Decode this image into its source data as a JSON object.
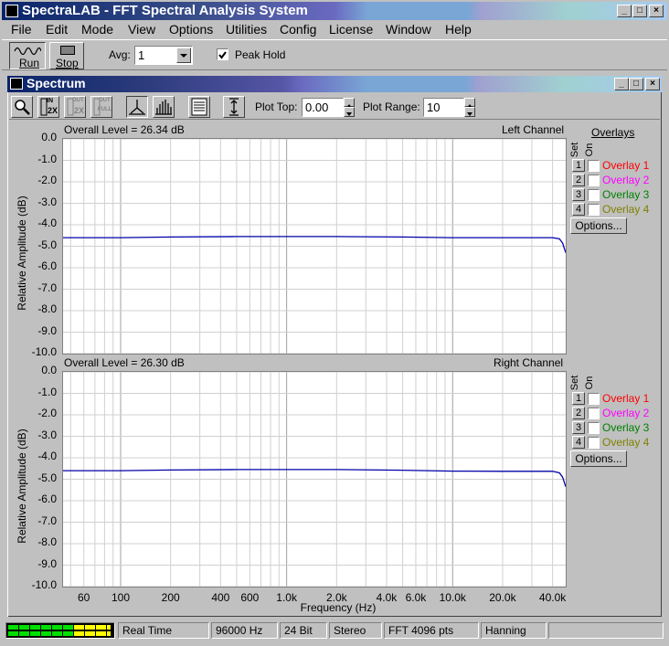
{
  "app": {
    "title": "SpectraLAB - FFT Spectral Analysis System",
    "window_buttons": [
      "_",
      "□",
      "×"
    ]
  },
  "menu": [
    "File",
    "Edit",
    "Mode",
    "View",
    "Options",
    "Utilities",
    "Config",
    "License",
    "Window",
    "Help"
  ],
  "toolbar": {
    "run_label": "Run",
    "stop_label": "Stop",
    "avg_label": "Avg:",
    "avg_value": "1",
    "peak_hold_label": "Peak Hold",
    "peak_hold_checked": true
  },
  "spectrum": {
    "title": "Spectrum",
    "plot_top_label": "Plot Top:",
    "plot_top_value": "0.00",
    "plot_range_label": "Plot Range:",
    "plot_range_value": "10",
    "tool_icons": [
      "zoom-icon",
      "scale-in-2x-icon",
      "scale-out-2x-icon",
      "scale-out-full-icon",
      "line-plot-icon",
      "bar-plot-icon",
      "data-table-icon",
      "fit-vertical-icon"
    ],
    "tool_labels": {
      "in2x_top": "IN",
      "in2x_bot": "2X",
      "out2x_top": "OUT",
      "out2x_bot": "2X",
      "outfull_top": "OUT",
      "outfull_bot": "FULL"
    }
  },
  "overlays": {
    "header": "Overlays",
    "set_label": "Set",
    "on_label": "On",
    "items": [
      {
        "num": "1",
        "label": "Overlay 1",
        "color": "#ff0000"
      },
      {
        "num": "2",
        "label": "Overlay 2",
        "color": "#ff00ff"
      },
      {
        "num": "3",
        "label": "Overlay 3",
        "color": "#008000"
      },
      {
        "num": "4",
        "label": "Overlay 4",
        "color": "#808000"
      }
    ],
    "options_label": "Options..."
  },
  "chart_data": [
    {
      "type": "line",
      "title": "Left Channel",
      "overall_level": "Overall Level = 26.34 dB",
      "ylabel": "Relative Amplitude (dB)",
      "ylim": [
        -10,
        0
      ],
      "yticks": [
        "0.0",
        "-1.0",
        "-2.0",
        "-3.0",
        "-4.0",
        "-5.0",
        "-6.0",
        "-7.0",
        "-8.0",
        "-9.0",
        "-10.0"
      ],
      "xscale": "log",
      "xlim": [
        45,
        48000
      ],
      "line_color": "#0000aa",
      "series": [
        {
          "x": [
            45,
            100,
            200,
            500,
            1000,
            2000,
            5000,
            10000,
            20000,
            40000,
            44000,
            46000,
            48000
          ],
          "y": [
            -4.6,
            -4.6,
            -4.57,
            -4.55,
            -4.55,
            -4.55,
            -4.57,
            -4.6,
            -4.6,
            -4.6,
            -4.65,
            -4.85,
            -5.3
          ]
        }
      ]
    },
    {
      "type": "line",
      "title": "Right Channel",
      "overall_level": "Overall Level = 26.30 dB",
      "ylabel": "Relative Amplitude (dB)",
      "ylim": [
        -10,
        0
      ],
      "yticks": [
        "0.0",
        "-1.0",
        "-2.0",
        "-3.0",
        "-4.0",
        "-5.0",
        "-6.0",
        "-7.0",
        "-8.0",
        "-9.0",
        "-10.0"
      ],
      "xscale": "log",
      "xlim": [
        45,
        48000
      ],
      "line_color": "#0000aa",
      "series": [
        {
          "x": [
            45,
            100,
            200,
            500,
            1000,
            2000,
            5000,
            10000,
            20000,
            40000,
            44000,
            46000,
            48000
          ],
          "y": [
            -4.6,
            -4.6,
            -4.57,
            -4.55,
            -4.55,
            -4.55,
            -4.58,
            -4.62,
            -4.63,
            -4.63,
            -4.7,
            -4.9,
            -5.35
          ]
        }
      ]
    }
  ],
  "xaxis": {
    "label": "Frequency (Hz)",
    "ticks": [
      {
        "v": 60,
        "t": "60"
      },
      {
        "v": 100,
        "t": "100"
      },
      {
        "v": 200,
        "t": "200"
      },
      {
        "v": 400,
        "t": "400"
      },
      {
        "v": 600,
        "t": "600"
      },
      {
        "v": 1000,
        "t": "1.0k"
      },
      {
        "v": 2000,
        "t": "2.0k"
      },
      {
        "v": 4000,
        "t": "4.0k"
      },
      {
        "v": 6000,
        "t": "6.0k"
      },
      {
        "v": 10000,
        "t": "10.0k"
      },
      {
        "v": 20000,
        "t": "20.0k"
      },
      {
        "v": 40000,
        "t": "40.0k"
      }
    ]
  },
  "status": {
    "mode": "Real Time",
    "rate": "96000 Hz",
    "bits": "24 Bit",
    "channels": "Stereo",
    "fft": "FFT 4096 pts",
    "window": "Hanning"
  }
}
